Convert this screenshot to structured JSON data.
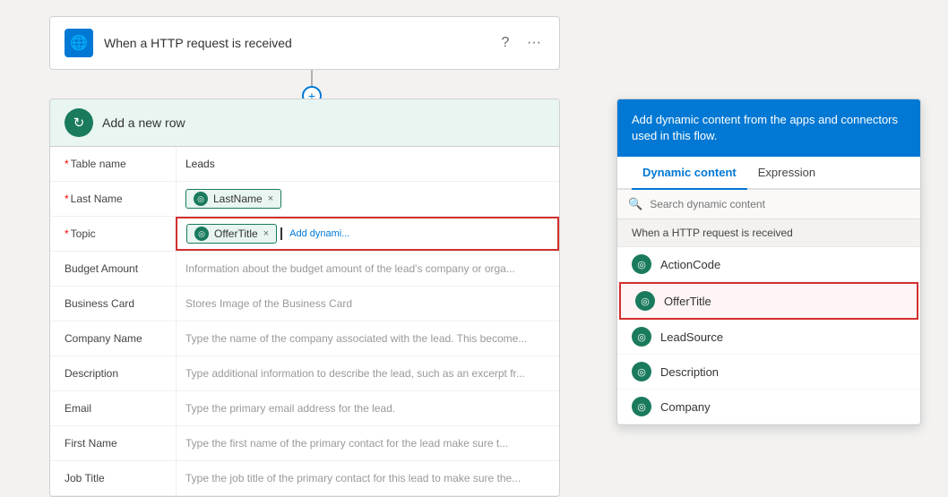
{
  "httpTrigger": {
    "title": "When a HTTP request is received",
    "icon": "🌐"
  },
  "connector": {
    "plusLabel": "+"
  },
  "actionCard": {
    "title": "Add a new row",
    "icon": "↻",
    "fields": [
      {
        "label": "* Table name",
        "type": "text",
        "value": "Leads",
        "required": true,
        "highlight": false
      },
      {
        "label": "* Last Name",
        "type": "tag",
        "tagValue": "LastName",
        "required": true,
        "highlight": false
      },
      {
        "label": "* Topic",
        "type": "tag",
        "tagValue": "OfferTitle",
        "required": true,
        "highlight": true,
        "addDynamic": "Add dynami..."
      },
      {
        "label": "Budget Amount",
        "type": "placeholder",
        "placeholder": "Information about the budget amount of the lead's company or orga...",
        "highlight": false
      },
      {
        "label": "Business Card",
        "type": "placeholder",
        "placeholder": "Stores Image of the Business Card",
        "highlight": false
      },
      {
        "label": "Company Name",
        "type": "placeholder",
        "placeholder": "Type the name of the company associated with the lead. This become...",
        "highlight": false
      },
      {
        "label": "Description",
        "type": "placeholder",
        "placeholder": "Type additional information to describe the lead, such as an excerpt fr...",
        "highlight": false
      },
      {
        "label": "Email",
        "type": "placeholder",
        "placeholder": "Type the primary email address for the lead.",
        "highlight": false
      },
      {
        "label": "First Name",
        "type": "placeholder",
        "placeholder": "Type the first name of the primary contact for the lead make sure t...",
        "highlight": false
      },
      {
        "label": "Job Title",
        "type": "placeholder",
        "placeholder": "Type the job title of the primary contact for this lead to make sure the...",
        "highlight": false
      }
    ]
  },
  "dynamicPanel": {
    "header": "Add dynamic content from the apps and connectors used in this flow.",
    "tabs": [
      {
        "label": "Dynamic content",
        "active": true
      },
      {
        "label": "Expression",
        "active": false
      }
    ],
    "searchPlaceholder": "Search dynamic content",
    "sectionTitle": "When a HTTP request is received",
    "items": [
      {
        "label": "ActionCode",
        "highlighted": false
      },
      {
        "label": "OfferTitle",
        "highlighted": true
      },
      {
        "label": "LeadSource",
        "highlighted": false
      },
      {
        "label": "Description",
        "highlighted": false
      },
      {
        "label": "Company",
        "highlighted": false
      }
    ]
  }
}
